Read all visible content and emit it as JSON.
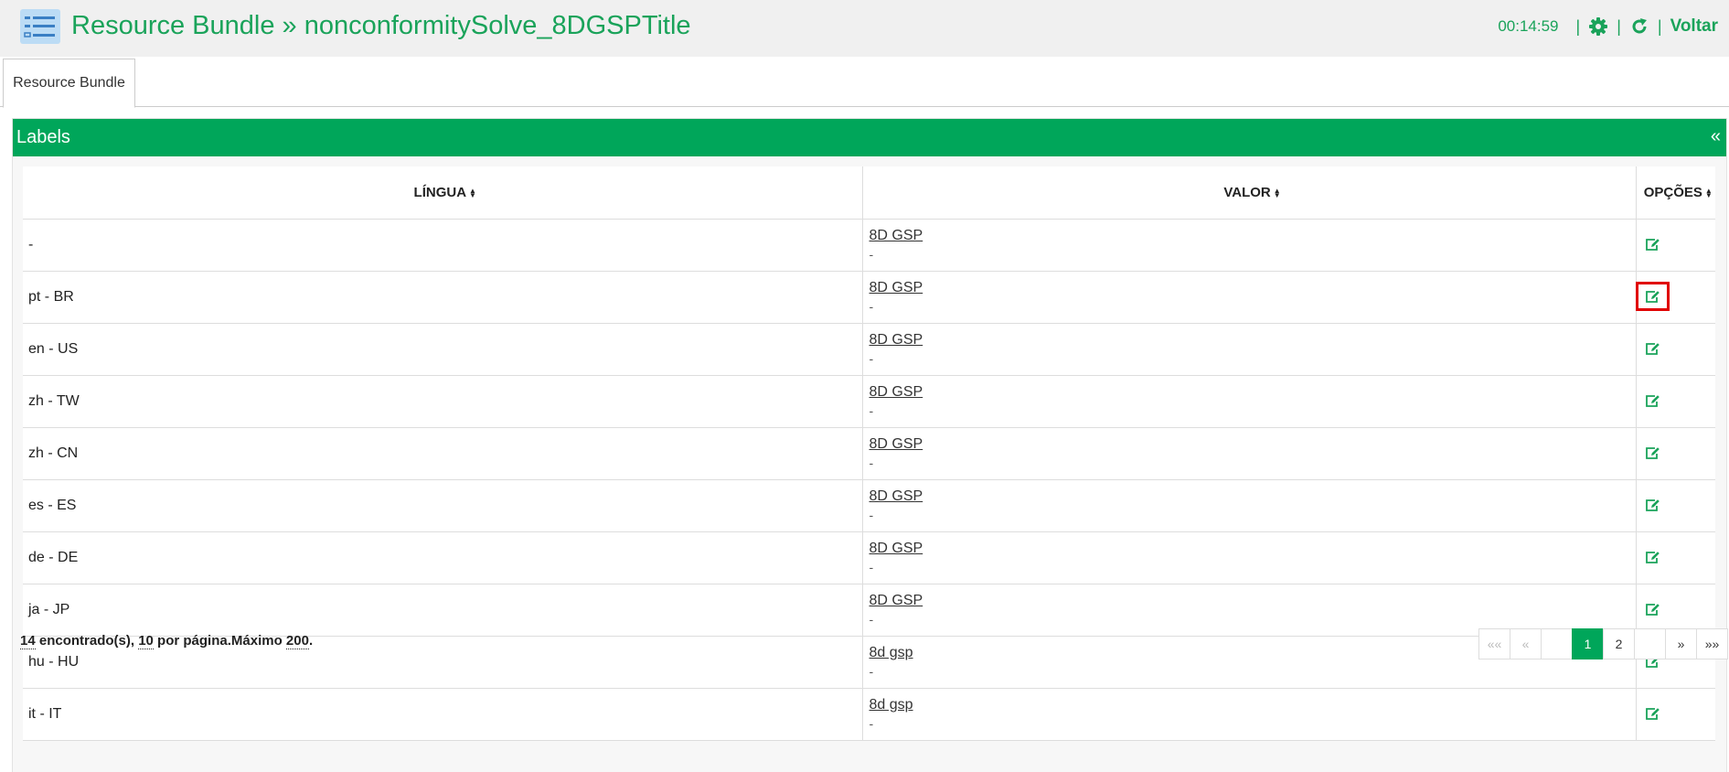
{
  "header": {
    "title": "Resource Bundle » nonconformitySolve_8DGSPTitle",
    "timer": "00:14:59",
    "separator": "|",
    "back_label": "Voltar"
  },
  "tabs": [
    {
      "label": "Resource Bundle",
      "active": true
    }
  ],
  "panel": {
    "title": "Labels",
    "collapse_label": "«"
  },
  "table": {
    "columns": [
      "LÍNGUA",
      "VALOR",
      "OPÇÕES"
    ],
    "rows": [
      {
        "lang": "-",
        "value": "8D GSP",
        "sub": "-"
      },
      {
        "lang": "pt - BR",
        "value": "8D GSP",
        "sub": "-"
      },
      {
        "lang": "en - US",
        "value": "8D GSP",
        "sub": "-"
      },
      {
        "lang": "zh - TW",
        "value": "8D GSP",
        "sub": "-"
      },
      {
        "lang": "zh - CN",
        "value": "8D GSP",
        "sub": "-"
      },
      {
        "lang": "es - ES",
        "value": "8D GSP",
        "sub": "-"
      },
      {
        "lang": "de - DE",
        "value": "8D GSP",
        "sub": "-"
      },
      {
        "lang": "ja - JP",
        "value": "8D GSP",
        "sub": "-"
      },
      {
        "lang": "hu - HU",
        "value": "8d gsp",
        "sub": "-"
      },
      {
        "lang": "it - IT",
        "value": "8d gsp",
        "sub": "-"
      }
    ]
  },
  "footer": {
    "found_count": "14",
    "found_text": " encontrado(s), ",
    "per_page": "10",
    "per_page_text": " por página.Máximo ",
    "max": "200",
    "end": "."
  },
  "pagination": {
    "first": "««",
    "prev": "«",
    "pages": [
      "1",
      "2"
    ],
    "current_page": "1",
    "next": "»",
    "last": "»»"
  },
  "colors": {
    "accent": "#00a65a",
    "title_green": "#1aa35a",
    "highlight": "#e00000"
  }
}
